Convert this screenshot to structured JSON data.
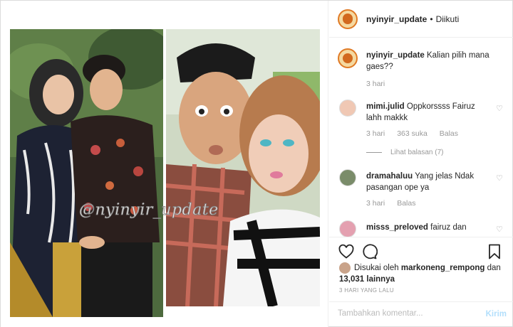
{
  "post": {
    "watermark": "@nyinyir_update"
  },
  "header": {
    "username": "nyinyir_update",
    "separator": "•",
    "follow_status": "Diikuti"
  },
  "caption": {
    "username": "nyinyir_update",
    "text": "Kalian pilih mana gaes??",
    "time": "3 hari"
  },
  "comments": [
    {
      "username": "mimi.julid",
      "text": "Oppkorssss Fairuz lahh makkk",
      "time": "3 hari",
      "likes": "363 suka",
      "reply_label": "Balas",
      "view_replies": "Lihat balasan (7)"
    },
    {
      "username": "dramahaluu",
      "text": "Yang jelas Ndak pasangan ope ya",
      "time": "3 hari",
      "reply_label": "Balas"
    },
    {
      "username": "misss_preloved",
      "text": "fairuz dan"
    }
  ],
  "actions": {
    "liked_by_prefix": "Disukai oleh",
    "liked_by_user": "markoneng_rempong",
    "liked_by_and": "dan",
    "liked_by_count": "13,031 lainnya",
    "timestamp": "3 HARI YANG LALU"
  },
  "add_comment": {
    "placeholder": "Tambahkan komentar...",
    "post_label": "Kirim"
  },
  "icons": {
    "heart": "heart-icon",
    "comment": "comment-icon",
    "bookmark": "bookmark-icon"
  }
}
